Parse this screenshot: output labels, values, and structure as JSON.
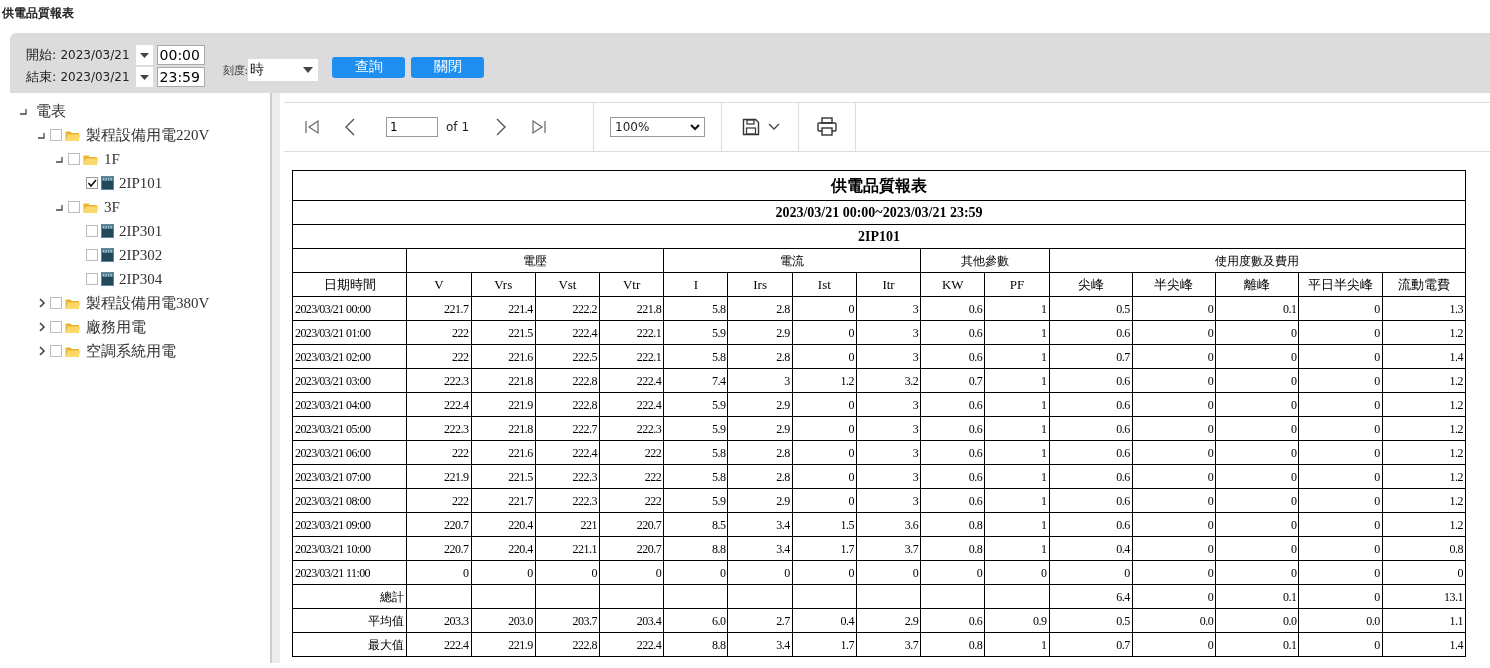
{
  "page_title": "供電品質報表",
  "filter": {
    "start_label": "開始:",
    "start_date": "2023/03/21",
    "start_time": "00:00",
    "end_label": "結束:",
    "end_date": "2023/03/21",
    "end_time": "23:59",
    "scale_label": "刻度:",
    "scale_value": "時",
    "buttons": [
      "查詢",
      "關閉"
    ]
  },
  "tree": [
    {
      "kind": "root",
      "label": "電表",
      "expanded": true,
      "children": [
        {
          "kind": "folder",
          "label": "製程設備用電220V",
          "checked": false,
          "expanded": true,
          "children": [
            {
              "kind": "folder",
              "label": "1F",
              "checked": false,
              "expanded": true,
              "children": [
                {
                  "kind": "meter",
                  "label": "2IP101",
                  "checked": true
                }
              ]
            },
            {
              "kind": "folder",
              "label": "3F",
              "checked": false,
              "expanded": true,
              "children": [
                {
                  "kind": "meter",
                  "label": "2IP301",
                  "checked": false
                },
                {
                  "kind": "meter",
                  "label": "2IP302",
                  "checked": false
                },
                {
                  "kind": "meter",
                  "label": "2IP304",
                  "checked": false
                }
              ]
            }
          ]
        },
        {
          "kind": "folder",
          "label": "製程設備用電380V",
          "checked": false,
          "expanded": false
        },
        {
          "kind": "folder",
          "label": "廠務用電",
          "checked": false,
          "expanded": false
        },
        {
          "kind": "folder",
          "label": "空調系統用電",
          "checked": false,
          "expanded": false
        }
      ]
    }
  ],
  "viewer_toolbar": {
    "page": "1",
    "page_count": "of 1",
    "zoom": "100%"
  },
  "report": {
    "title": "供電品質報表",
    "period": "2023/03/21  00:00~2023/03/21  23:59",
    "meter": "2IP101",
    "groups": [
      {
        "columns": [
          "日期時間"
        ]
      },
      {
        "label": "電壓",
        "columns": [
          "V",
          "Vrs",
          "Vst",
          "Vtr"
        ]
      },
      {
        "label": "電流",
        "columns": [
          "I",
          "Irs",
          "Ist",
          "Itr"
        ]
      },
      {
        "label": "其他參數",
        "columns": [
          "KW",
          "PF"
        ]
      },
      {
        "label": "使用度數及費用",
        "columns": [
          "尖峰",
          "半尖峰",
          "離峰",
          "平日半尖峰",
          "流動電費"
        ]
      }
    ],
    "rows": [
      {
        "kind": "data",
        "cells": [
          "2023/03/21 00:00",
          "221.7",
          "221.4",
          "222.2",
          "221.8",
          "5.8",
          "2.8",
          "0",
          "3",
          "0.6",
          "1",
          "0.5",
          "0",
          "0.1",
          "0",
          "1.3"
        ]
      },
      {
        "kind": "data",
        "cells": [
          "2023/03/21 01:00",
          "222",
          "221.5",
          "222.4",
          "222.1",
          "5.9",
          "2.9",
          "0",
          "3",
          "0.6",
          "1",
          "0.6",
          "0",
          "0",
          "0",
          "1.2"
        ]
      },
      {
        "kind": "data",
        "cells": [
          "2023/03/21 02:00",
          "222",
          "221.6",
          "222.5",
          "222.1",
          "5.8",
          "2.8",
          "0",
          "3",
          "0.6",
          "1",
          "0.7",
          "0",
          "0",
          "0",
          "1.4"
        ]
      },
      {
        "kind": "data",
        "cells": [
          "2023/03/21 03:00",
          "222.3",
          "221.8",
          "222.8",
          "222.4",
          "7.4",
          "3",
          "1.2",
          "3.2",
          "0.7",
          "1",
          "0.6",
          "0",
          "0",
          "0",
          "1.2"
        ]
      },
      {
        "kind": "data",
        "cells": [
          "2023/03/21 04:00",
          "222.4",
          "221.9",
          "222.8",
          "222.4",
          "5.9",
          "2.9",
          "0",
          "3",
          "0.6",
          "1",
          "0.6",
          "0",
          "0",
          "0",
          "1.2"
        ]
      },
      {
        "kind": "data",
        "cells": [
          "2023/03/21 05:00",
          "222.3",
          "221.8",
          "222.7",
          "222.3",
          "5.9",
          "2.9",
          "0",
          "3",
          "0.6",
          "1",
          "0.6",
          "0",
          "0",
          "0",
          "1.2"
        ]
      },
      {
        "kind": "data",
        "cells": [
          "2023/03/21 06:00",
          "222",
          "221.6",
          "222.4",
          "222",
          "5.8",
          "2.8",
          "0",
          "3",
          "0.6",
          "1",
          "0.6",
          "0",
          "0",
          "0",
          "1.2"
        ]
      },
      {
        "kind": "data",
        "cells": [
          "2023/03/21 07:00",
          "221.9",
          "221.5",
          "222.3",
          "222",
          "5.8",
          "2.8",
          "0",
          "3",
          "0.6",
          "1",
          "0.6",
          "0",
          "0",
          "0",
          "1.2"
        ]
      },
      {
        "kind": "data",
        "cells": [
          "2023/03/21 08:00",
          "222",
          "221.7",
          "222.3",
          "222",
          "5.9",
          "2.9",
          "0",
          "3",
          "0.6",
          "1",
          "0.6",
          "0",
          "0",
          "0",
          "1.2"
        ]
      },
      {
        "kind": "data",
        "cells": [
          "2023/03/21 09:00",
          "220.7",
          "220.4",
          "221",
          "220.7",
          "8.5",
          "3.4",
          "1.5",
          "3.6",
          "0.8",
          "1",
          "0.6",
          "0",
          "0",
          "0",
          "1.2"
        ]
      },
      {
        "kind": "data",
        "cells": [
          "2023/03/21 10:00",
          "220.7",
          "220.4",
          "221.1",
          "220.7",
          "8.8",
          "3.4",
          "1.7",
          "3.7",
          "0.8",
          "1",
          "0.4",
          "0",
          "0",
          "0",
          "0.8"
        ]
      },
      {
        "kind": "data",
        "cells": [
          "2023/03/21 11:00",
          "0",
          "0",
          "0",
          "0",
          "0",
          "0",
          "0",
          "0",
          "0",
          "0",
          "0",
          "0",
          "0",
          "0",
          "0"
        ]
      },
      {
        "kind": "summary",
        "cells": [
          "總計",
          null,
          null,
          null,
          null,
          null,
          null,
          null,
          null,
          null,
          null,
          "6.4",
          "0",
          "0.1",
          "0",
          "13.1"
        ]
      },
      {
        "kind": "summary",
        "cells": [
          "平均值",
          "203.3",
          "203.0",
          "203.7",
          "203.4",
          "6.0",
          "2.7",
          "0.4",
          "2.9",
          "0.6",
          "0.9",
          "0.5",
          "0.0",
          "0.0",
          "0.0",
          "1.1"
        ]
      },
      {
        "kind": "summary",
        "cells": [
          "最大值",
          "222.4",
          "221.9",
          "222.8",
          "222.4",
          "8.8",
          "3.4",
          "1.7",
          "3.7",
          "0.8",
          "1",
          "0.7",
          "0",
          "0.1",
          "0",
          "1.4"
        ]
      }
    ]
  }
}
